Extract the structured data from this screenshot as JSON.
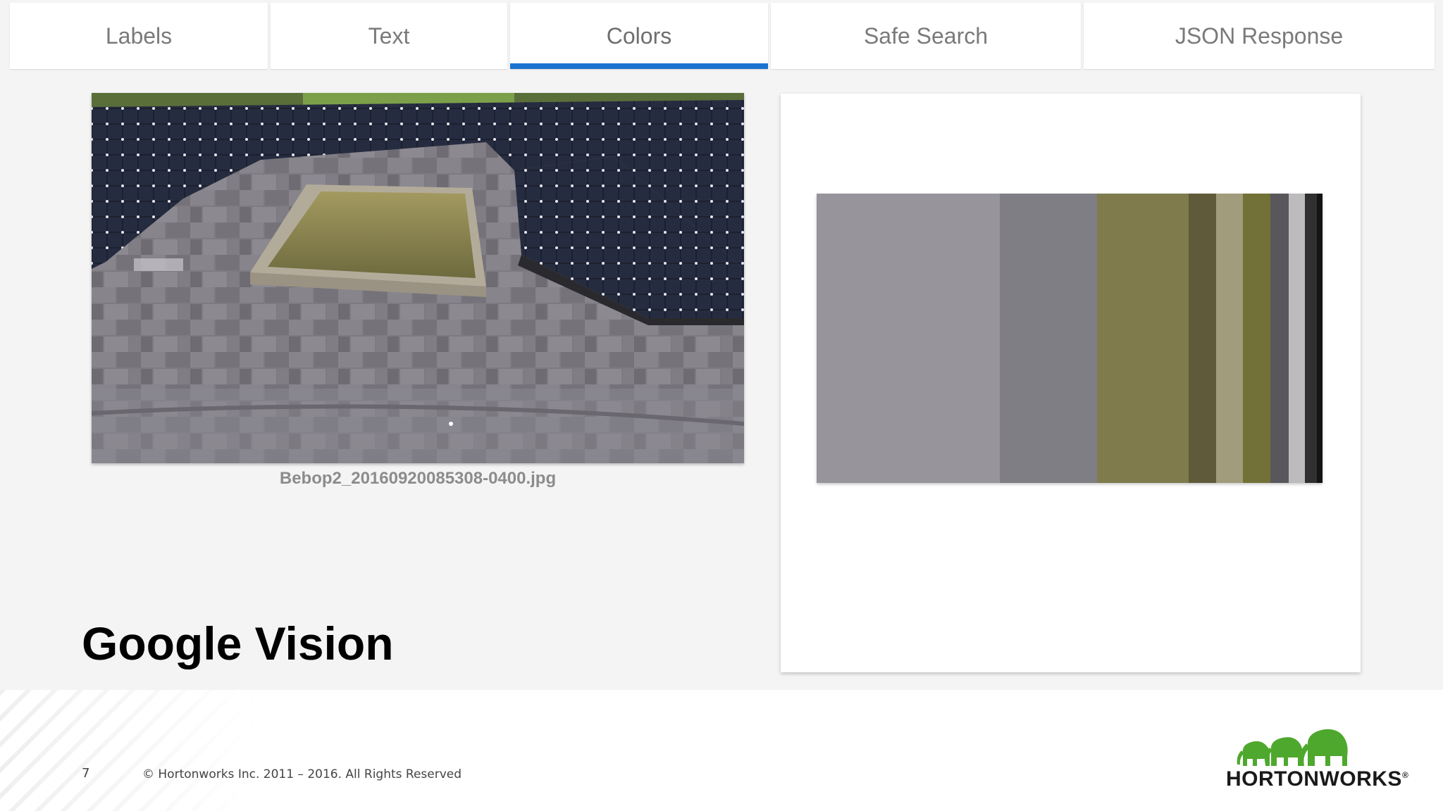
{
  "tabs": [
    {
      "label": "Labels",
      "active": false
    },
    {
      "label": "Text",
      "active": false
    },
    {
      "label": "Colors",
      "active": true
    },
    {
      "label": "Safe Search",
      "active": false
    },
    {
      "label": "JSON Response",
      "active": false
    }
  ],
  "accent_color": "#1a73d0",
  "image": {
    "caption": "Bebop2_20160920085308-0400.jpg"
  },
  "palette": [
    {
      "color": "#97959b",
      "fraction": 0.362
    },
    {
      "color": "#807e85",
      "fraction": 0.192
    },
    {
      "color": "#7f7b4d",
      "fraction": 0.182
    },
    {
      "color": "#5f5b3a",
      "fraction": 0.054
    },
    {
      "color": "#a19c7b",
      "fraction": 0.052
    },
    {
      "color": "#727138",
      "fraction": 0.055
    },
    {
      "color": "#59575b",
      "fraction": 0.036
    },
    {
      "color": "#bdbbbd",
      "fraction": 0.032
    },
    {
      "color": "#303031",
      "fraction": 0.024
    },
    {
      "color": "#141414",
      "fraction": 0.011
    }
  ],
  "slide": {
    "title": "Google Vision",
    "page_number": "7",
    "copyright": "© Hortonworks Inc. 2011 – 2016. All Rights Reserved",
    "brand": "HORTONWORKS",
    "brand_registered": "®"
  },
  "icons": {
    "brand_logo": "hortonworks-elephants-logo"
  }
}
